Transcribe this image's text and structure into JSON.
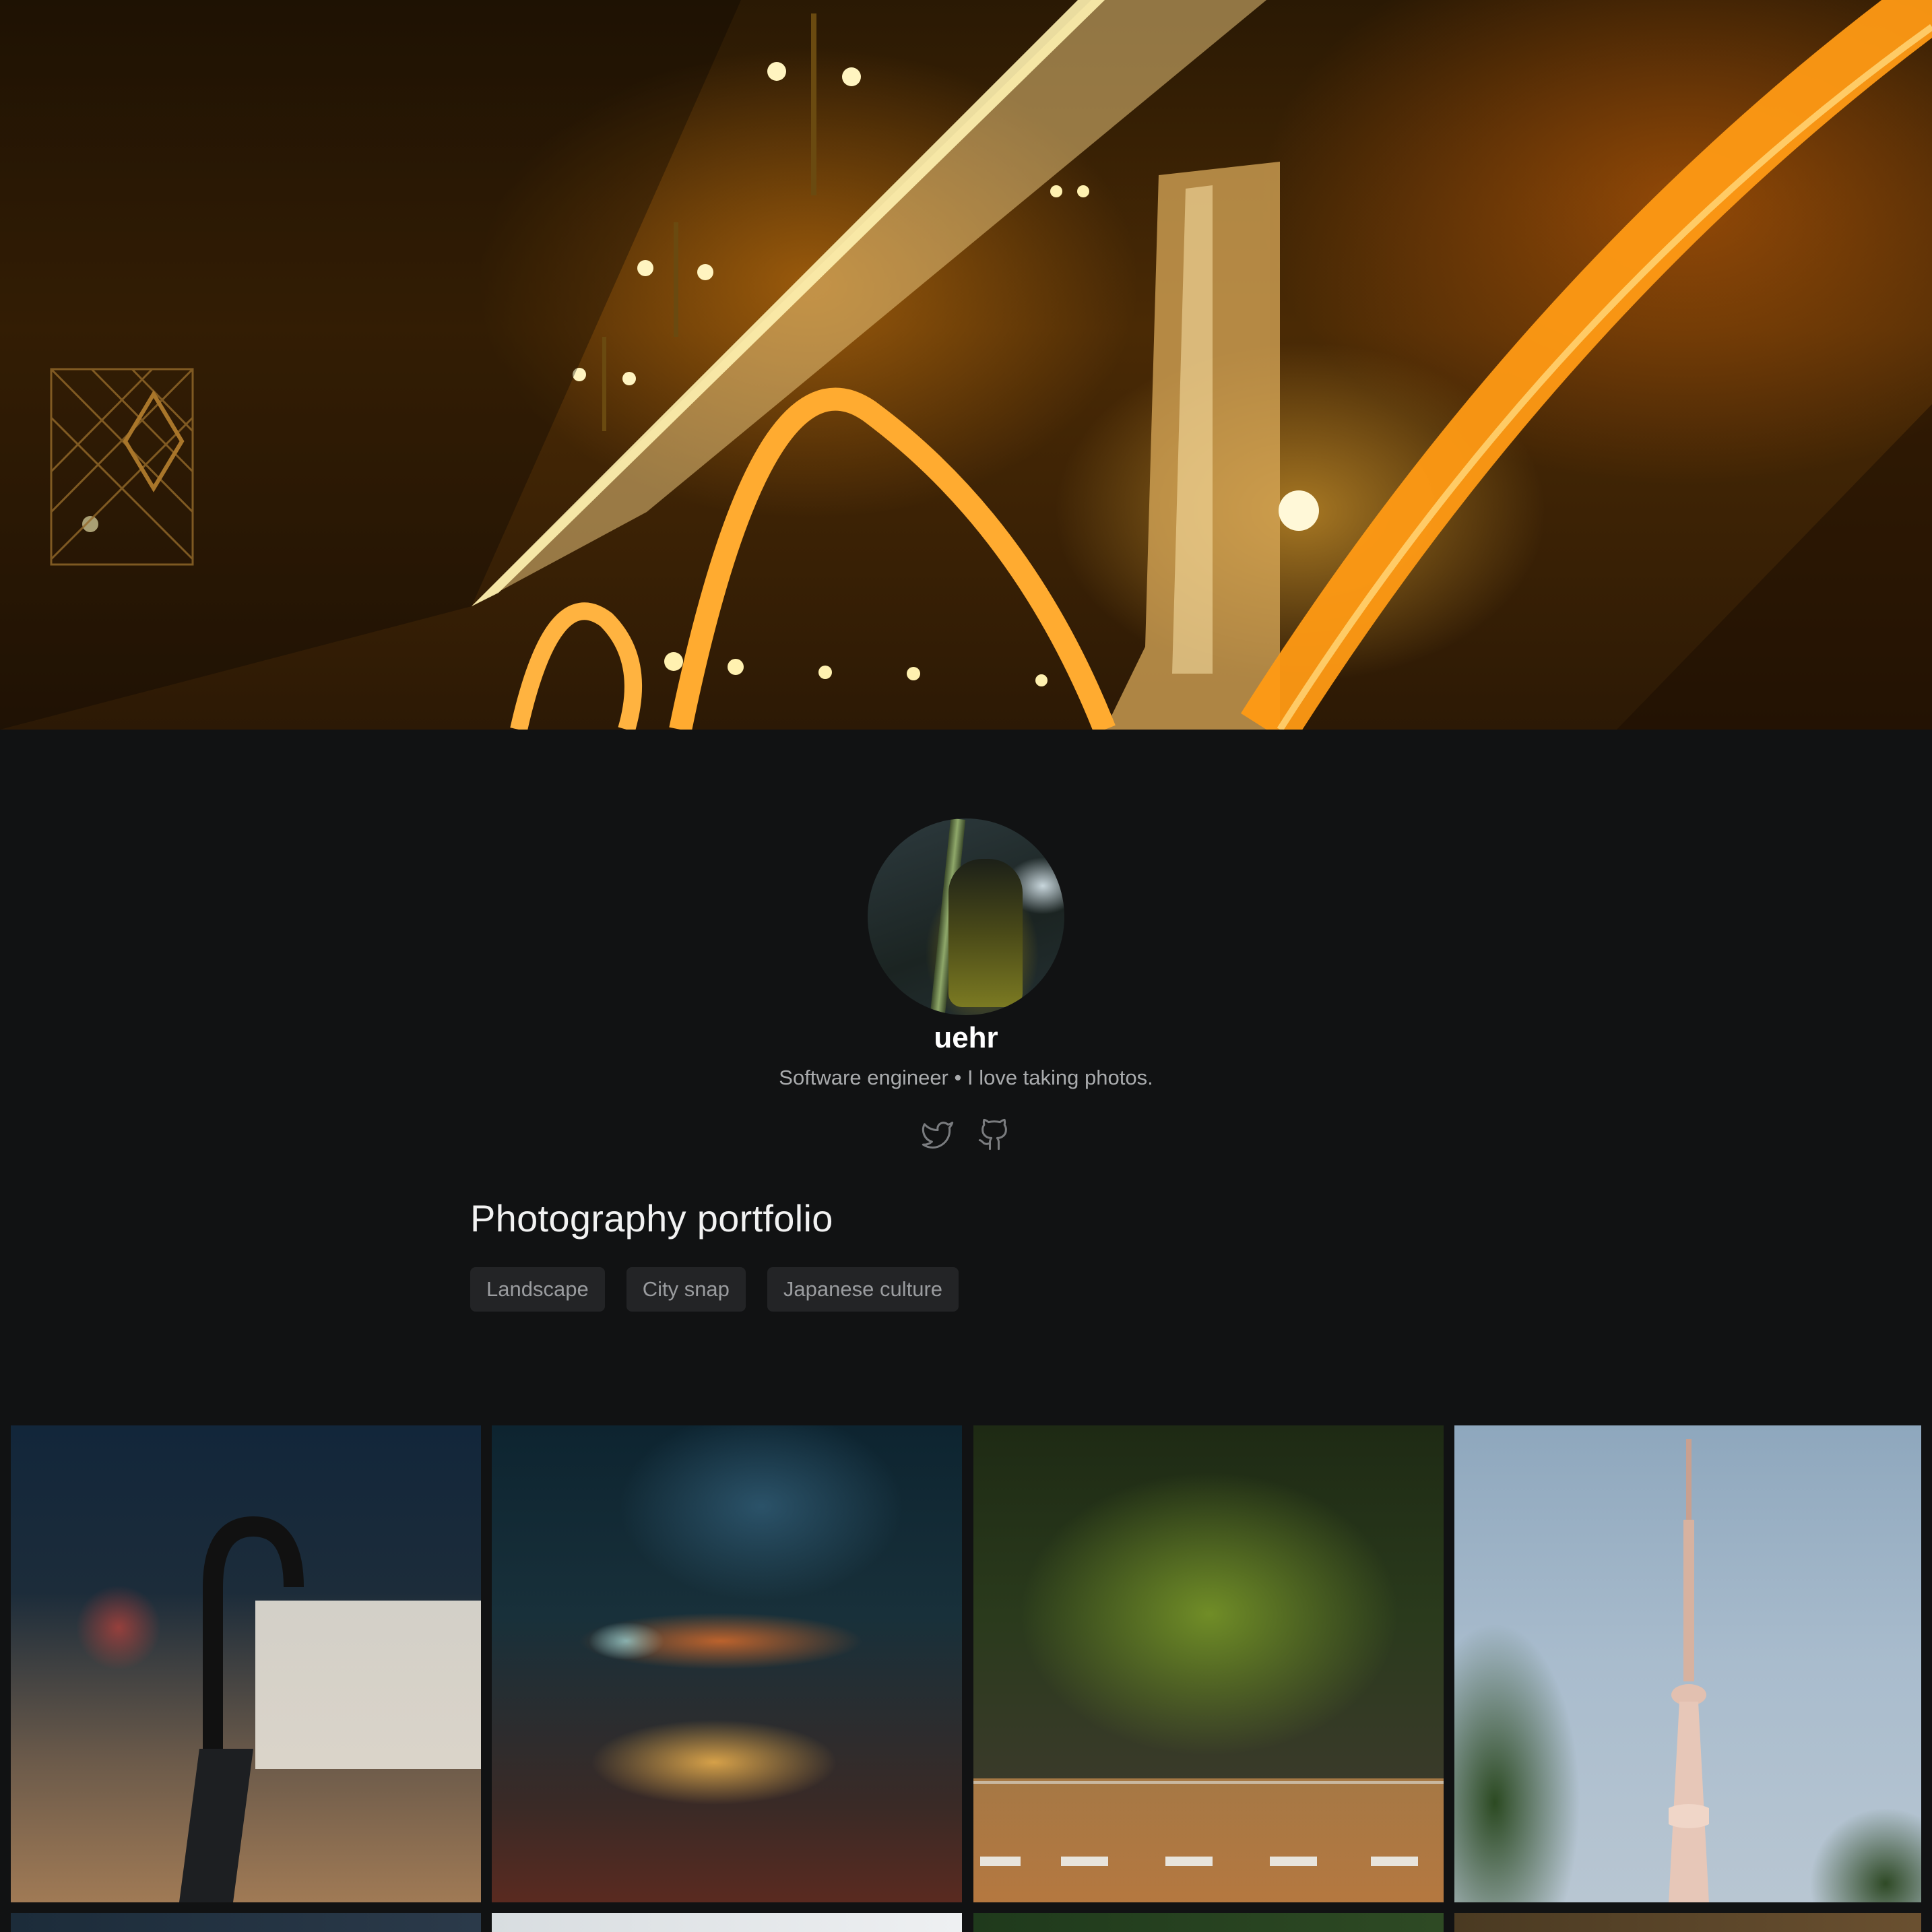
{
  "profile": {
    "name": "uehr",
    "bio": "Software engineer • I love taking photos."
  },
  "social": [
    {
      "icon": "twitter-icon"
    },
    {
      "icon": "github-icon"
    }
  ],
  "portfolio": {
    "title": "Photography portfolio",
    "tags": [
      "Landscape",
      "City snap",
      "Japanese culture"
    ]
  },
  "colors": {
    "background": "#111213",
    "tag_background": "#232426",
    "tag_text": "#9a9c9f",
    "bio_text": "#a9abad",
    "hero_accent": "#ff9a14"
  }
}
